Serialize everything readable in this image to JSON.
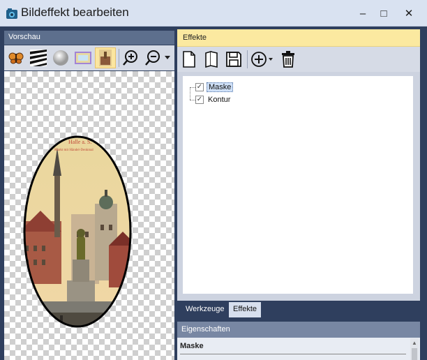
{
  "window": {
    "title": "Bildeffekt bearbeiten",
    "controls": {
      "minimize": "–",
      "maximize": "□",
      "close": "✕"
    }
  },
  "preview": {
    "header": "Vorschau",
    "toolbar_icons": [
      "butterfly-icon",
      "zebra-pattern-icon",
      "gray-circle-icon",
      "gradient-rect-icon",
      "image-thumbnail-icon",
      "zoom-in-icon",
      "zoom-out-icon",
      "dropdown-arrow-icon"
    ],
    "image": {
      "caption_line1": "Halle a. S.",
      "caption_line2": "Markt mit Händel-Denkmal",
      "frame_color": "#000000"
    }
  },
  "effects": {
    "header": "Effekte",
    "toolbar_icons": [
      "new-file-icon",
      "open-book-icon",
      "save-icon",
      "add-circle-icon",
      "trash-icon"
    ],
    "tree": [
      {
        "label": "Maske",
        "checked": true,
        "selected": true
      },
      {
        "label": "Kontur",
        "checked": true,
        "selected": false
      }
    ]
  },
  "tabs": [
    {
      "label": "Werkzeuge",
      "active": false
    },
    {
      "label": "Effekte",
      "active": true
    }
  ],
  "properties": {
    "header": "Eigenschaften",
    "section_title": "Maske"
  },
  "colors": {
    "panel_dark": "#2f3f5e",
    "accent_yellow": "#fbe9a0",
    "titlebar": "#d9e2f1"
  }
}
